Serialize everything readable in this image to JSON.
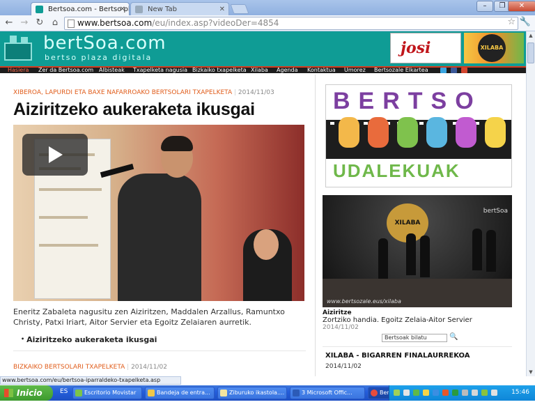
{
  "browser": {
    "tabs": [
      {
        "title": "Bertsoa.com - Bertso pla",
        "active": true
      },
      {
        "title": "New Tab",
        "active": false
      }
    ],
    "url_host": "www.bertsoa.com",
    "url_path": "/eu/index.asp?videoDer=4854",
    "status_url": "www.bertsoa.com/eu/bertsoa-iparraldeko-txapelketa.asp"
  },
  "site": {
    "logo_text": "bertSoa.com",
    "tagline": "bertso plaza digitala",
    "ad_josi": "josi",
    "ad_xilaba": "XILABA",
    "menu": [
      "Hasiera",
      "Zer da Bertsoa.com",
      "Albisteak",
      "Txapelketa nagusia",
      "Bizkaiko txapelketa",
      "Xilaba",
      "Agenda",
      "Kontaktua",
      "Umorez",
      "Bertsozale Elkartea"
    ]
  },
  "article": {
    "kicker": "XIBEROA, LAPURDI ETA BAXE NAFARROAKO BERTSOLARI TXAPELKETA",
    "date": "2014/11/03",
    "headline": "Aiziritzeko aukeraketa ikusgai",
    "summary": "Eneritz Zabaleta nagusitu zen Aiziritzen, Maddalen Arzallus, Ramuntxo Christy, Patxi Iriart, Aitor Servier eta Egoitz Zelaiaren aurretik.",
    "related_link": "Aiziritzeko aukeraketa ikusgai",
    "next_kicker": "BIZKAIKO BERTSOLARI TXAPELKETA",
    "next_date": "2014/11/02"
  },
  "sidebar": {
    "promo_top": "BERTSO",
    "promo_bottom": "UDALEKUAK",
    "video_brand": "bertSoa",
    "video_url": "www.bertsozale.eus/xilaba",
    "video_caption_title": "Aiziritze",
    "video_caption_desc": "Zortziko handia. Egoitz Zelaia-Aitor Servier",
    "video_caption_date": "2014/11/02",
    "video_search": "Bertsoak bilatu",
    "next_title": "XILABA - BIGARREN FINALAURREKOA",
    "next_date": "2014/11/02"
  },
  "taskbar": {
    "start_label": "Inicio",
    "lang": "ES",
    "buttons": [
      "Escritorio Movistar",
      "Bandeja de entra...",
      "Ziburuko ikastola....",
      "3 Microsoft Offic...",
      "Bertsoa.com - Ber..."
    ],
    "clock": "15:46"
  },
  "colors": {
    "header_teal": "#0f9c95",
    "kicker_orange": "#e05c1a",
    "menu_dark": "#1d1d1d",
    "taskbar_blue": "#245edb"
  }
}
